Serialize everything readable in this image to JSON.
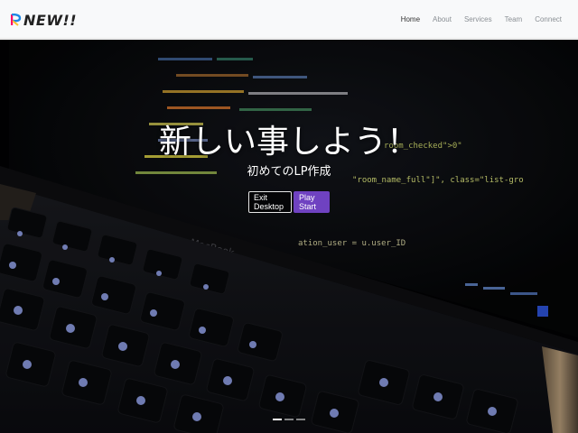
{
  "brand": {
    "text": "NEW!!"
  },
  "nav": {
    "items": [
      {
        "label": "Home",
        "active": true
      },
      {
        "label": "About",
        "active": false
      },
      {
        "label": "Services",
        "active": false
      },
      {
        "label": "Team",
        "active": false
      },
      {
        "label": "Connect",
        "active": false
      }
    ]
  },
  "hero": {
    "headline": "新しい事しよう！",
    "subline": "初めてのLP作成",
    "buttons": {
      "exit_label": "Exit Desktop",
      "play_label": "Play Start"
    },
    "background_label": "MacBook",
    "code_lines": [
      "room_checked\">0\"",
      "\"room_name_full\"]\",  class=\"list-gro",
      "ation_user = u.user_ID"
    ],
    "indicators": {
      "count": 3,
      "active_index": 0
    }
  },
  "colors": {
    "primary": "#6f42c1",
    "navbar_bg": "#f8f9fa",
    "nav_link": "#8a8f94",
    "nav_active": "#333333"
  }
}
